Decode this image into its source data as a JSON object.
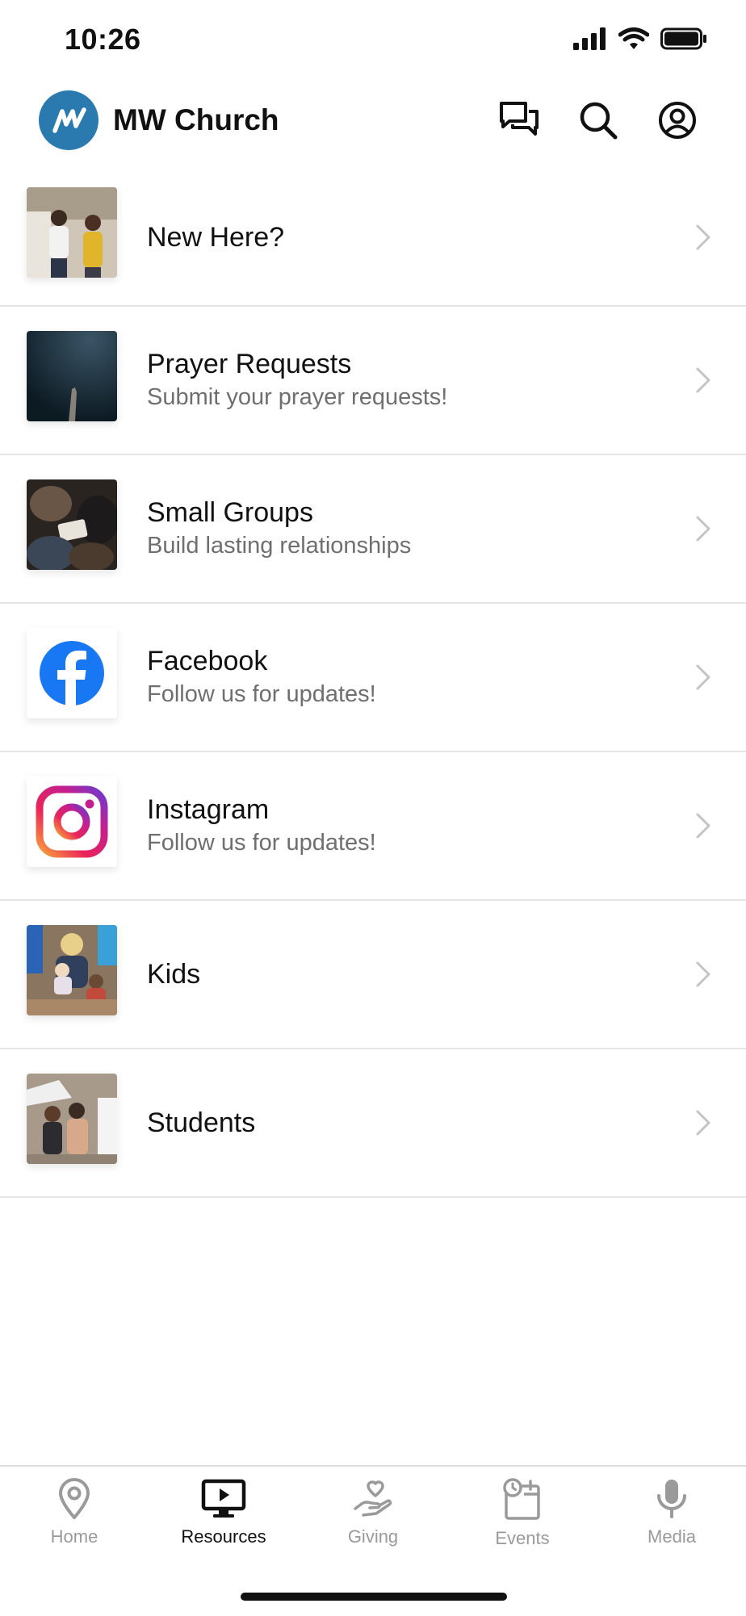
{
  "status_bar": {
    "time": "10:26"
  },
  "header": {
    "title": "MW Church"
  },
  "items": [
    {
      "title": "New Here?",
      "subtitle": ""
    },
    {
      "title": "Prayer Requests",
      "subtitle": "Submit your prayer requests!"
    },
    {
      "title": "Small Groups",
      "subtitle": "Build lasting relationships"
    },
    {
      "title": "Facebook",
      "subtitle": "Follow us for updates!"
    },
    {
      "title": "Instagram",
      "subtitle": "Follow us for updates!"
    },
    {
      "title": "Kids",
      "subtitle": ""
    },
    {
      "title": "Students",
      "subtitle": ""
    }
  ],
  "tabs": [
    {
      "label": "Home",
      "icon": "map-pin-icon",
      "active": false
    },
    {
      "label": "Resources",
      "icon": "tv-play-icon",
      "active": true
    },
    {
      "label": "Giving",
      "icon": "hand-heart-icon",
      "active": false
    },
    {
      "label": "Events",
      "icon": "calendar-clock-icon",
      "active": false
    },
    {
      "label": "Media",
      "icon": "microphone-icon",
      "active": false
    }
  ],
  "colors": {
    "brand": "#2a7ab0",
    "facebook": "#1877f2",
    "active_tab": "#111111",
    "inactive_tab": "#9a9a9a"
  }
}
